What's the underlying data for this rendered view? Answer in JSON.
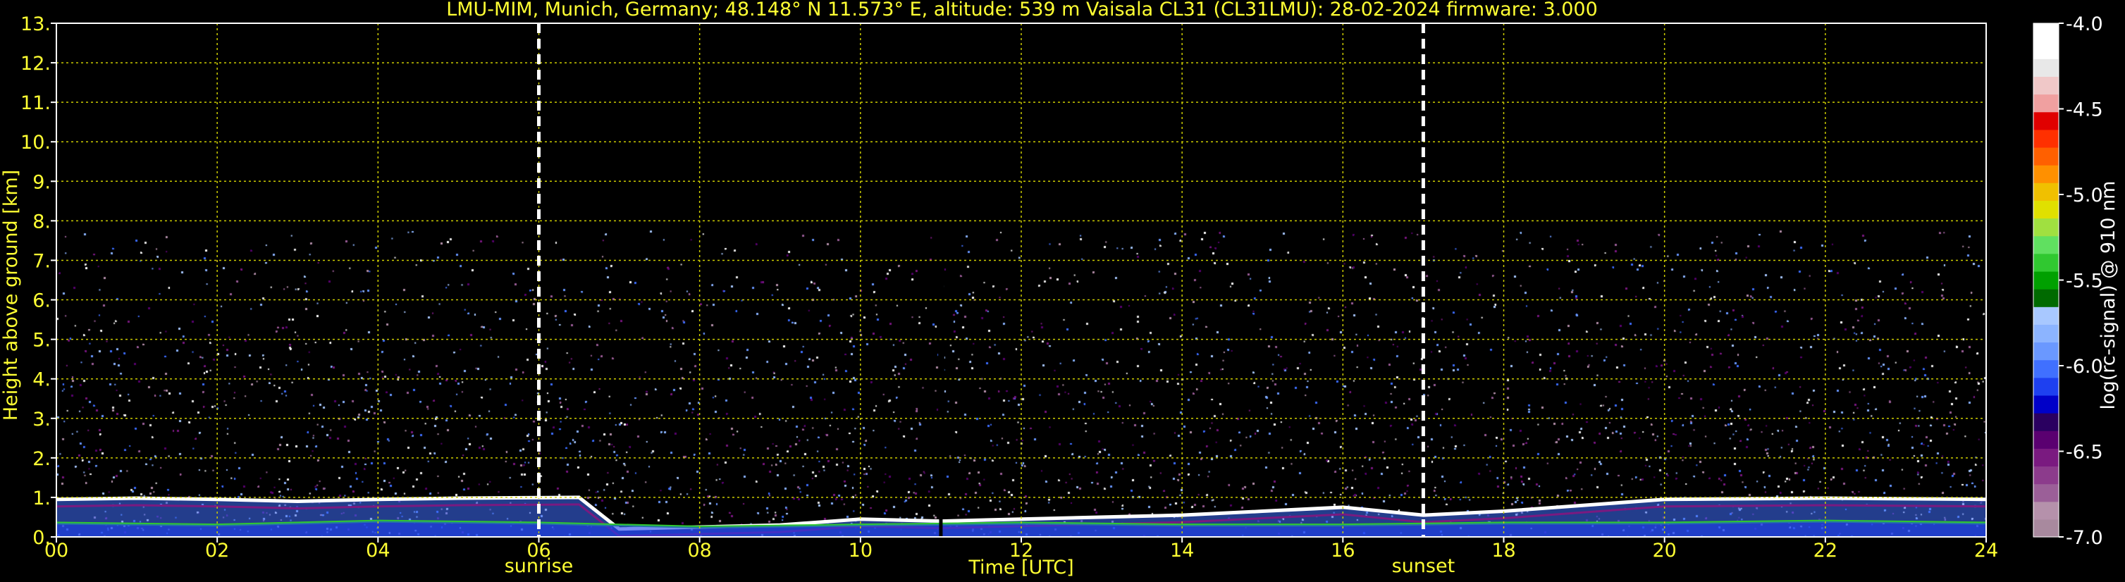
{
  "chart_data": {
    "type": "heatmap",
    "title": "LMU-MIM, Munich, Germany; 48.148° N 11.573° E, altitude: 539 m    Vaisala CL31 (CL31LMU): 28-02-2024    firmware: 3.000",
    "xlabel": "Time [UTC]",
    "ylabel": "Height above ground [km]",
    "xlim": [
      0,
      24
    ],
    "ylim": [
      0,
      13
    ],
    "x_ticks": [
      "00",
      "02",
      "04",
      "06",
      "08",
      "10",
      "12",
      "14",
      "16",
      "18",
      "20",
      "22",
      "24"
    ],
    "y_ticks": [
      "0.",
      "1.",
      "2.",
      "3.",
      "4.",
      "5.",
      "6.",
      "7.",
      "8.",
      "9.",
      "10.",
      "11.",
      "12.",
      "13."
    ],
    "grid": true,
    "events": [
      {
        "label": "sunrise",
        "time": 6.0
      },
      {
        "label": "sunset",
        "time": 17.0
      }
    ],
    "data_dropout_time": 11.0,
    "noise_top_km": 7.75,
    "colorbar": {
      "label": "log(rc-signal) @ 910 nm",
      "ticks": [
        "-4.0",
        "-4.5",
        "-5.0",
        "-5.5",
        "-6.0",
        "-6.5",
        "-7.0"
      ],
      "range": [
        -7.0,
        -4.0
      ],
      "colors": [
        "#a8899e",
        "#b591ab",
        "#9b5f98",
        "#8c3b8c",
        "#7a1a80",
        "#5a0070",
        "#2a0060",
        "#0000c8",
        "#1e40f0",
        "#4070ff",
        "#6a98ff",
        "#8cb4ff",
        "#a8c8ff",
        "#006a00",
        "#00a000",
        "#30c830",
        "#60e060",
        "#a0e040",
        "#e0e000",
        "#f0c000",
        "#ff9000",
        "#ff6000",
        "#ff3000",
        "#e00000",
        "#f0a0a0",
        "#f0c8c8",
        "#e8e8e8",
        "#ffffff",
        "#ffffff"
      ]
    },
    "layers": [
      {
        "name": "cloud-base",
        "points": [
          [
            0,
            0.95
          ],
          [
            1,
            0.98
          ],
          [
            2,
            0.95
          ],
          [
            3,
            0.9
          ],
          [
            4,
            0.95
          ],
          [
            5,
            0.98
          ],
          [
            6.5,
            1.0
          ],
          [
            7,
            0.2
          ],
          [
            9,
            0.3
          ],
          [
            10,
            0.45
          ],
          [
            11,
            0.4
          ],
          [
            12,
            0.45
          ],
          [
            14,
            0.55
          ],
          [
            15,
            0.65
          ],
          [
            16,
            0.75
          ],
          [
            17,
            0.55
          ],
          [
            18,
            0.65
          ],
          [
            19,
            0.8
          ],
          [
            20,
            0.95
          ],
          [
            22,
            0.98
          ],
          [
            24,
            0.95
          ]
        ]
      },
      {
        "name": "boundary-layer",
        "points": [
          [
            0,
            0.35
          ],
          [
            2,
            0.3
          ],
          [
            4,
            0.4
          ],
          [
            6,
            0.35
          ],
          [
            8,
            0.25
          ],
          [
            10,
            0.3
          ],
          [
            12,
            0.35
          ],
          [
            14,
            0.3
          ],
          [
            16,
            0.3
          ],
          [
            18,
            0.35
          ],
          [
            20,
            0.35
          ],
          [
            22,
            0.4
          ],
          [
            24,
            0.35
          ]
        ]
      }
    ]
  }
}
